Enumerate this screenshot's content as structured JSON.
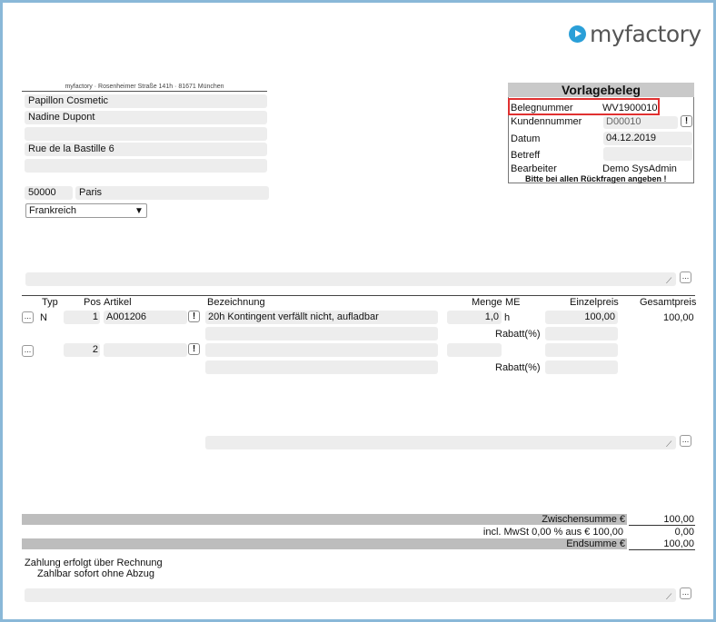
{
  "logo": {
    "text": "myfactory"
  },
  "sender_line": "myfactory · Rosenheimer Straße 141h · 81671 München",
  "address": {
    "line1": "Papillon Cosmetic",
    "line2": "Nadine Dupont",
    "line3": "",
    "line4": "Rue de la Bastille 6",
    "line5": "",
    "zip": "50000",
    "city": "Paris",
    "country": "Frankreich"
  },
  "doc": {
    "title": "Vorlagebeleg",
    "belegnummer_label": "Belegnummer",
    "belegnummer": "WV1900010",
    "kundennummer_label": "Kundennummer",
    "kundennummer": "D00010",
    "datum_label": "Datum",
    "datum": "04.12.2019",
    "betreff_label": "Betreff",
    "betreff": "",
    "bearbeiter_label": "Bearbeiter",
    "bearbeiter": "Demo SysAdmin",
    "note": "Bitte bei allen Rückfragen angeben !"
  },
  "columns": {
    "typ": "Typ",
    "pos": "Pos",
    "artikel": "Artikel",
    "bezeichnung": "Bezeichnung",
    "menge": "Menge",
    "me": "ME",
    "einzelpreis": "Einzelpreis",
    "gesamtpreis": "Gesamtpreis"
  },
  "rows": [
    {
      "typ": "N",
      "pos": "1",
      "artikel": "A001206",
      "bezeichnung": "20h Kontingent verfällt nicht, aufladbar",
      "menge": "1,0",
      "me": "h",
      "einzelpreis": "100,00",
      "gesamtpreis": "100,00",
      "rabatt_label": "Rabatt(%)"
    },
    {
      "typ": "",
      "pos": "2",
      "artikel": "",
      "bezeichnung": "",
      "menge": "",
      "me": "",
      "einzelpreis": "",
      "gesamtpreis": "",
      "rabatt_label": "Rabatt(%)"
    }
  ],
  "totals": {
    "zwischensumme_label": "Zwischensumme €",
    "zwischensumme": "100,00",
    "mwst_label": "incl. MwSt 0,00 % aus € 100,00",
    "mwst": "0,00",
    "endsumme_label": "Endsumme €",
    "endsumme": "100,00"
  },
  "footer": {
    "line1": "Zahlung erfolgt über Rechnung",
    "line2": "Zahlbar sofort ohne Abzug"
  },
  "icons": {
    "dropdown": "▼",
    "ellipsis": "...",
    "exclaim": "!",
    "resize": "⟋"
  }
}
